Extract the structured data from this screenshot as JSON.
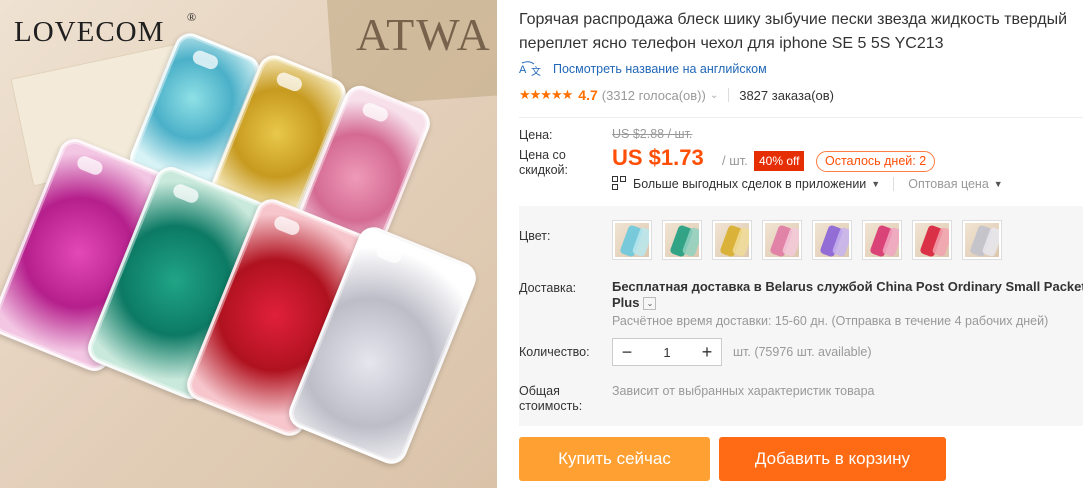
{
  "image": {
    "brand": "LOVECOM",
    "brand_mark": "®",
    "background_text": "ATWA"
  },
  "product": {
    "title": "Горячая распродажа блеск шику зыбучие пески звезда жидкость твердый переплет ясно телефон чехол для iphone SE 5 5S YC213",
    "translate_link": "Посмотреть название на английском",
    "rating": {
      "stars": "★★★★★",
      "value": "4.7",
      "votes": "(3312 голоса(ов))",
      "orders": "3827 заказа(ов)"
    }
  },
  "price": {
    "label": "Цена:",
    "old": "US $2.88 / шт.",
    "discount_label": "Цена со скидкой:",
    "new": "US $1.73",
    "per_unit": "/ шт.",
    "discount": "40% off",
    "days_left": "Осталось дней: 2",
    "app_deals": "Больше выгодных сделок в приложении",
    "wholesale": "Оптовая цена"
  },
  "color": {
    "label": "Цвет:",
    "swatches": [
      {
        "name": "blue",
        "c": "#6cc9dd",
        "c2": "#b9e7ef"
      },
      {
        "name": "green",
        "c": "#1f9d7f",
        "c2": "#8fd1bf"
      },
      {
        "name": "gold",
        "c": "#d8ae2b",
        "c2": "#f0dc98"
      },
      {
        "name": "pink",
        "c": "#e07aa3",
        "c2": "#f3c9da"
      },
      {
        "name": "purple",
        "c": "#8a62d8",
        "c2": "#c7b3f0"
      },
      {
        "name": "rose",
        "c": "#d8336f",
        "c2": "#f1a6c2"
      },
      {
        "name": "red",
        "c": "#d81f3a",
        "c2": "#f2a2ae"
      },
      {
        "name": "silver",
        "c": "#c2c2cc",
        "c2": "#e8e8ee"
      }
    ]
  },
  "shipping": {
    "label": "Доставка:",
    "main": "Бесплатная доставка в Belarus службой China Post Ordinary Small Packet Plus",
    "estimate": "Расчётное время доставки: 15-60 дн. (Отправка в течение 4 рабочих дней)"
  },
  "quantity": {
    "label": "Количество:",
    "value": "1",
    "minus": "−",
    "plus": "+",
    "available": "шт. (75976 шт. available)"
  },
  "total": {
    "label": "Общая стоимость:",
    "note": "Зависит от выбранных характеристик товара"
  },
  "actions": {
    "buy_now": "Купить сейчас",
    "add_to_cart": "Добавить в корзину"
  },
  "colors": {
    "accent_orange": "#ff4e06",
    "buy_button": "#ffa033",
    "cart_button": "#ff6a14",
    "link_blue": "#2167b7",
    "badge_red": "#e62e04"
  }
}
